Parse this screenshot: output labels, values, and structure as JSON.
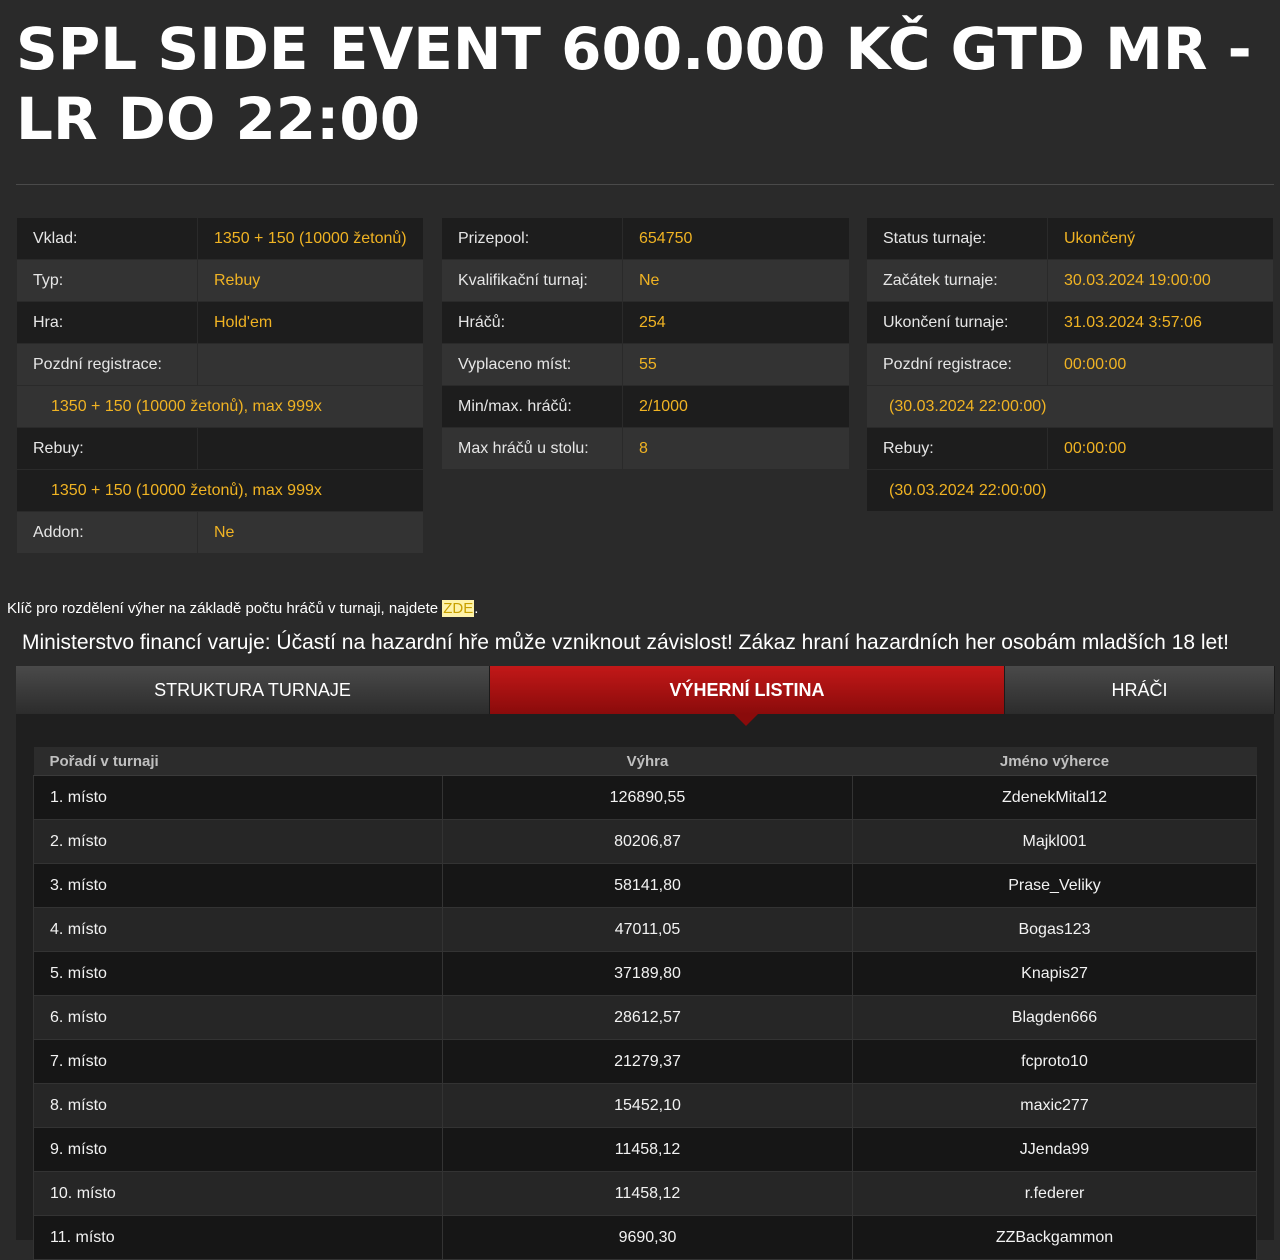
{
  "title": "SPL SIDE EVENT 600.000 KČ GTD MR - LR DO 22:00",
  "info1": {
    "vklad_label": "Vklad:",
    "vklad_value": "1350 + 150 (10000 žetonů)",
    "typ_label": "Typ:",
    "typ_value": "Rebuy",
    "hra_label": "Hra:",
    "hra_value": "Hold'em",
    "late_label": "Pozdní registrace:",
    "late_value": "1350 + 150 (10000 žetonů), max 999x",
    "rebuy_label": "Rebuy:",
    "rebuy_value": "1350 + 150 (10000 žetonů), max 999x",
    "addon_label": "Addon:",
    "addon_value": "Ne"
  },
  "info2": {
    "prize_label": "Prizepool:",
    "prize_value": "654750",
    "qual_label": "Kvalifikační turnaj:",
    "qual_value": "Ne",
    "players_label": "Hráčů:",
    "players_value": "254",
    "paid_label": "Vyplaceno míst:",
    "paid_value": "55",
    "minmax_label": "Min/max. hráčů:",
    "minmax_value": "2/1000",
    "table_label": "Max hráčů u stolu:",
    "table_value": "8"
  },
  "info3": {
    "status_label": "Status turnaje:",
    "status_value": "Ukončený",
    "start_label": "Začátek turnaje:",
    "start_value": "30.03.2024 19:00:00",
    "end_label": "Ukončení turnaje:",
    "end_value": "31.03.2024 3:57:06",
    "late_label": "Pozdní registrace:",
    "late_value": "00:00:00",
    "late_date": "(30.03.2024 22:00:00)",
    "rebuy_label": "Rebuy:",
    "rebuy_value": "00:00:00",
    "rebuy_date": "(30.03.2024 22:00:00)"
  },
  "note": {
    "text": "Klíč pro rozdělení výher na základě počtu hráčů v turnaji, najdete ",
    "link": "ZDE",
    "end": "."
  },
  "warning": "Ministerstvo financí varuje: Účastí na hazardní hře může vzniknout závislost! Zákaz hraní hazardních her osobám mladších 18 let!",
  "tabs": [
    "STRUKTURA TURNAJE",
    "VÝHERNÍ LISTINA",
    "HRÁČI"
  ],
  "results": {
    "headers": [
      "Pořadí v turnaji",
      "Výhra",
      "Jméno výherce"
    ],
    "rows": [
      [
        "1. místo",
        "126890,55",
        "ZdenekMital12"
      ],
      [
        "2. místo",
        "80206,87",
        "Majkl001"
      ],
      [
        "3. místo",
        "58141,80",
        "Prase_Veliky"
      ],
      [
        "4. místo",
        "47011,05",
        "Bogas123"
      ],
      [
        "5. místo",
        "37189,80",
        "Knapis27"
      ],
      [
        "6. místo",
        "28612,57",
        "Blagden666"
      ],
      [
        "7. místo",
        "21279,37",
        "fcproto10"
      ],
      [
        "8. místo",
        "15452,10",
        "maxic277"
      ],
      [
        "9. místo",
        "11458,12",
        "JJenda99"
      ],
      [
        "10. místo",
        "11458,12",
        "r.federer"
      ],
      [
        "11. místo",
        "9690,30",
        "ZZBackgammon"
      ]
    ]
  }
}
